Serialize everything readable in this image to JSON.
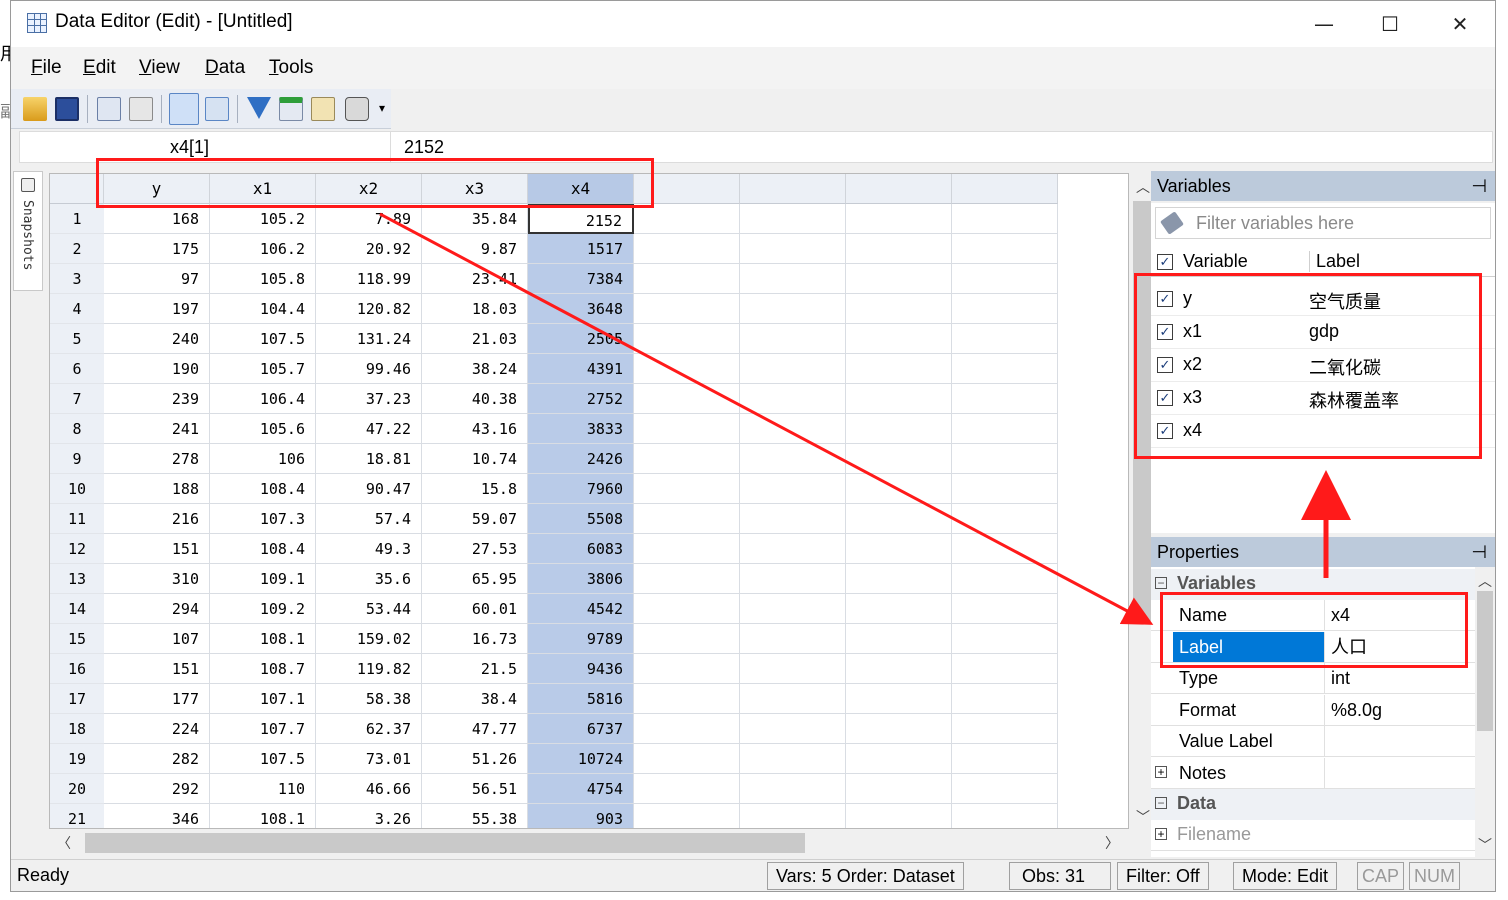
{
  "window": {
    "title": "Data Editor (Edit) - [Untitled]",
    "minimize": "—",
    "maximize": "☐",
    "close": "✕"
  },
  "menu": [
    {
      "label": "File",
      "key": "F",
      "rest": "ile"
    },
    {
      "label": "Edit",
      "key": "E",
      "rest": "dit"
    },
    {
      "label": "View",
      "key": "V",
      "rest": "iew"
    },
    {
      "label": "Data",
      "key": "D",
      "rest": "ata"
    },
    {
      "label": "Tools",
      "key": "T",
      "rest": "ools"
    }
  ],
  "toolbar": {
    "icons": [
      "open-icon",
      "save-icon",
      "copy-icon",
      "paste-icon",
      "edit-mode-icon",
      "browse-mode-icon",
      "filter-icon",
      "variables-manager-icon",
      "properties-icon",
      "snapshot-icon"
    ],
    "overflow": "▾"
  },
  "cellbar": {
    "ref": "x4[1]",
    "value": "2152"
  },
  "snapshots": {
    "label": "Snapshots"
  },
  "grid": {
    "columns": [
      "y",
      "x1",
      "x2",
      "x3",
      "x4"
    ],
    "rows": [
      [
        "1",
        "168",
        "105.2",
        "7.89",
        "35.84",
        "2152"
      ],
      [
        "2",
        "175",
        "106.2",
        "20.92",
        "9.87",
        "1517"
      ],
      [
        "3",
        "97",
        "105.8",
        "118.99",
        "23.41",
        "7384"
      ],
      [
        "4",
        "197",
        "104.4",
        "120.82",
        "18.03",
        "3648"
      ],
      [
        "5",
        "240",
        "107.5",
        "131.24",
        "21.03",
        "2505"
      ],
      [
        "6",
        "190",
        "105.7",
        "99.46",
        "38.24",
        "4391"
      ],
      [
        "7",
        "239",
        "106.4",
        "37.23",
        "40.38",
        "2752"
      ],
      [
        "8",
        "241",
        "105.6",
        "47.22",
        "43.16",
        "3833"
      ],
      [
        "9",
        "278",
        "106",
        "18.81",
        "10.74",
        "2426"
      ],
      [
        "10",
        "188",
        "108.4",
        "90.47",
        "15.8",
        "7960"
      ],
      [
        "11",
        "216",
        "107.3",
        "57.4",
        "59.07",
        "5508"
      ],
      [
        "12",
        "151",
        "108.4",
        "49.3",
        "27.53",
        "6083"
      ],
      [
        "13",
        "310",
        "109.1",
        "35.6",
        "65.95",
        "3806"
      ],
      [
        "14",
        "294",
        "109.2",
        "53.44",
        "60.01",
        "4542"
      ],
      [
        "15",
        "107",
        "108.1",
        "159.02",
        "16.73",
        "9789"
      ],
      [
        "16",
        "151",
        "108.7",
        "119.82",
        "21.5",
        "9436"
      ],
      [
        "17",
        "177",
        "107.1",
        "58.38",
        "38.4",
        "5816"
      ],
      [
        "18",
        "224",
        "107.7",
        "62.37",
        "47.77",
        "6737"
      ],
      [
        "19",
        "282",
        "107.5",
        "73.01",
        "51.26",
        "10724"
      ],
      [
        "20",
        "292",
        "110",
        "46.66",
        "56.51",
        "4754"
      ],
      [
        "21",
        "346",
        "108.1",
        "3.26",
        "55.38",
        "903"
      ]
    ]
  },
  "variables_panel": {
    "title": "Variables",
    "pin": "⊣",
    "filter_placeholder": "Filter variables here",
    "header_variable": "Variable",
    "header_label": "Label",
    "items": [
      {
        "name": "y",
        "label": "空气质量"
      },
      {
        "name": "x1",
        "label": "gdp"
      },
      {
        "name": "x2",
        "label": "二氧化碳"
      },
      {
        "name": "x3",
        "label": "森林覆盖率"
      },
      {
        "name": "x4",
        "label": ""
      }
    ]
  },
  "properties_panel": {
    "title": "Properties",
    "group_variables": "Variables",
    "rows": [
      {
        "key": "Name",
        "value": "x4"
      },
      {
        "key": "Label",
        "value": "人口"
      },
      {
        "key": "Type",
        "value": "int"
      },
      {
        "key": "Format",
        "value": "%8.0g"
      },
      {
        "key": "Value Label",
        "value": ""
      },
      {
        "key": "Notes",
        "value": ""
      }
    ],
    "group_data": "Data",
    "data_rows": [
      {
        "key": "Filename",
        "value": ""
      }
    ]
  },
  "status": {
    "ready": "Ready",
    "vars": "Vars: 5  Order: Dataset",
    "obs": "Obs: 31",
    "filter": "Filter: Off",
    "mode": "Mode: Edit",
    "cap": "CAP",
    "num": "NUM"
  },
  "background": {
    "left_glyph_1": "用",
    "left_glyph_2": "副"
  },
  "colors": {
    "annotation_red": "#ff1a1a",
    "selection_blue": "#b9cbe8",
    "panel_header": "#bccadb",
    "label_selected": "#0078d7"
  }
}
